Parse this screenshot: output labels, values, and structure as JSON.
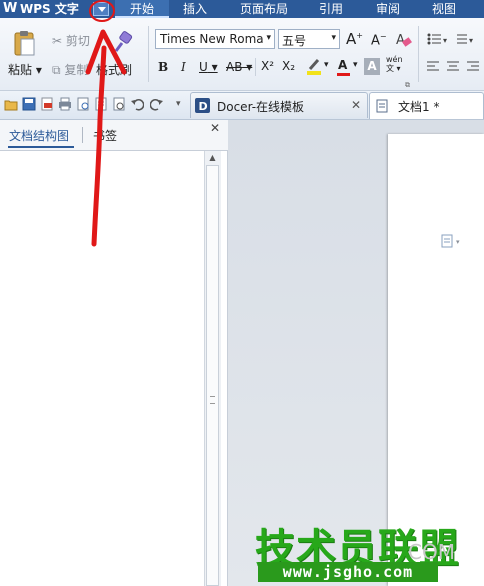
{
  "app": {
    "name": "WPS 文字",
    "logo": "W"
  },
  "menu": {
    "tabs": [
      "开始",
      "插入",
      "页面布局",
      "引用",
      "审阅",
      "视图"
    ]
  },
  "ribbon": {
    "paste_label": "粘贴",
    "cut_label": "剪切",
    "copy_label": "复制",
    "format_painter_label": "格式刷",
    "font_name": "Times New Roma",
    "font_size": "五号",
    "bold": "B",
    "italic": "I",
    "underline": "U",
    "strikethrough": "AB",
    "superscript": "X²",
    "subscript": "X₂",
    "grow_font": "A",
    "shrink_font": "A",
    "font_color": "A",
    "char_shading": "A",
    "phonetic": "wén"
  },
  "doc_tabs": [
    {
      "label": "Docer-在线模板",
      "close": "✕"
    },
    {
      "label": "文档1 *"
    }
  ],
  "left_panel": {
    "tabs": [
      "文档结构图",
      "书签"
    ],
    "close": "✕"
  },
  "watermark": {
    "main": "技术员联盟",
    "url": "www.jsgho.com",
    "suffix": "COM"
  },
  "colors": {
    "titlebar": "#2c5a99",
    "annotation": "#e01818",
    "watermark": "#27a81a"
  }
}
